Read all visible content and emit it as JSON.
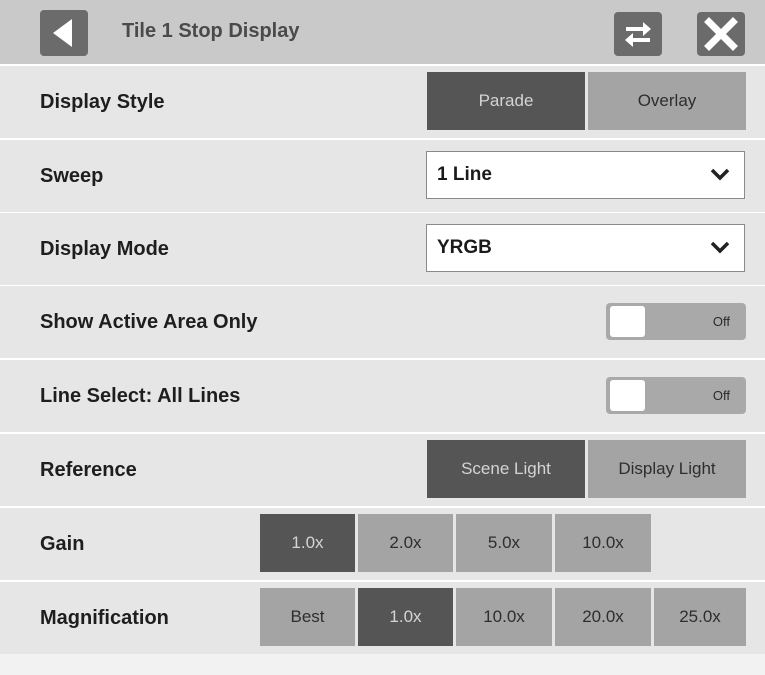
{
  "header": {
    "title": "Tile 1 Stop Display",
    "back_icon": "back-arrow-icon",
    "swap_icon": "swap-arrows-icon",
    "close_icon": "close-x-icon"
  },
  "rows": {
    "display_style": {
      "label": "Display Style",
      "options": [
        "Parade",
        "Overlay"
      ],
      "selected": "Parade"
    },
    "sweep": {
      "label": "Sweep",
      "value": "1 Line"
    },
    "display_mode": {
      "label": "Display Mode",
      "value": "YRGB"
    },
    "show_active_area": {
      "label": "Show Active Area Only",
      "state": "Off"
    },
    "line_select": {
      "label": "Line Select: All Lines",
      "state": "Off"
    },
    "reference": {
      "label": "Reference",
      "options": [
        "Scene Light",
        "Display Light"
      ],
      "selected": "Scene Light"
    },
    "gain": {
      "label": "Gain",
      "options": [
        "1.0x",
        "2.0x",
        "5.0x",
        "10.0x"
      ],
      "selected": "1.0x"
    },
    "magnification": {
      "label": "Magnification",
      "options": [
        "Best",
        "1.0x",
        "10.0x",
        "20.0x",
        "25.0x"
      ],
      "selected": "1.0x"
    }
  },
  "colors": {
    "header_bg": "#c9c9c9",
    "row_bg": "#e6e6e6",
    "selected_bg": "#555555",
    "unselected_bg": "#a4a4a4"
  }
}
